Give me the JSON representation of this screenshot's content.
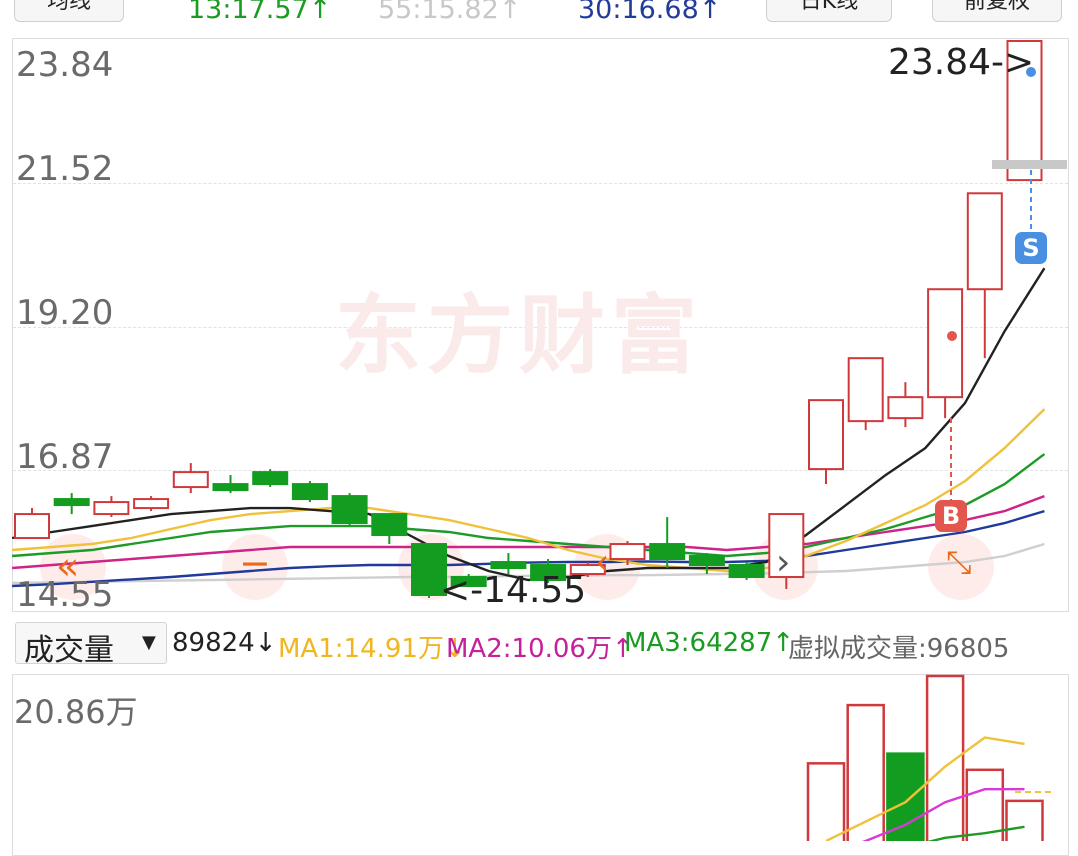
{
  "top": {
    "left_btn": "均线",
    "ma1_value": "13:17.57↑",
    "ma2_value": "55:15.82↑",
    "ma3_value": "30:16.68↑",
    "period_btn": "日K线",
    "fq_btn": "前复权"
  },
  "chart": {
    "y_labels": [
      "23.84",
      "21.52",
      "19.20",
      "16.87",
      "14.55"
    ],
    "max_marker": "23.84->",
    "min_marker": "<-14.55",
    "watermark": "东方财富",
    "signal_s": "S",
    "signal_b": "B"
  },
  "volume_bar": {
    "dropdown_label": "成交量",
    "vol": "89824↓",
    "ma1": "MA1:14.91万↓",
    "ma2": "MA2:10.06万↑",
    "ma3": "MA3:64287↑",
    "virtual": "虚拟成交量:96805"
  },
  "volume_chart": {
    "max_label": "20.86万"
  },
  "colors": {
    "up": "#d0393c",
    "down": "#139d20",
    "ma_black": "#222222",
    "ma_yellow": "#f0c13a",
    "ma_green": "#1e9b26",
    "ma_magenta": "#cc2488",
    "ma_blue": "#1f3a9a",
    "ma_gray": "#cfcfcf"
  },
  "chart_data": {
    "type": "candlestick",
    "ylim": [
      14.55,
      23.84
    ],
    "candles": [
      {
        "open": 15.55,
        "close": 15.95,
        "high": 16.05,
        "low": 15.55
      },
      {
        "open": 16.2,
        "close": 16.1,
        "high": 16.3,
        "low": 15.95
      },
      {
        "open": 15.95,
        "close": 16.15,
        "high": 16.25,
        "low": 15.9
      },
      {
        "open": 16.05,
        "close": 16.2,
        "high": 16.25,
        "low": 16.0
      },
      {
        "open": 16.4,
        "close": 16.65,
        "high": 16.8,
        "low": 16.3
      },
      {
        "open": 16.45,
        "close": 16.35,
        "high": 16.6,
        "low": 16.3
      },
      {
        "open": 16.65,
        "close": 16.45,
        "high": 16.7,
        "low": 16.4
      },
      {
        "open": 16.45,
        "close": 16.2,
        "high": 16.5,
        "low": 16.15
      },
      {
        "open": 16.25,
        "close": 15.8,
        "high": 16.3,
        "low": 15.75
      },
      {
        "open": 15.95,
        "close": 15.6,
        "high": 15.95,
        "low": 15.45
      },
      {
        "open": 15.45,
        "close": 14.6,
        "high": 15.45,
        "low": 14.55
      },
      {
        "open": 14.9,
        "close": 14.75,
        "high": 14.95,
        "low": 14.75
      },
      {
        "open": 15.15,
        "close": 15.05,
        "high": 15.3,
        "low": 14.95
      },
      {
        "open": 15.1,
        "close": 14.85,
        "high": 15.2,
        "low": 14.8
      },
      {
        "open": 14.95,
        "close": 15.1,
        "high": 15.15,
        "low": 14.9
      },
      {
        "open": 15.2,
        "close": 15.45,
        "high": 15.5,
        "low": 15.1
      },
      {
        "open": 15.45,
        "close": 15.2,
        "high": 15.9,
        "low": 15.05
      },
      {
        "open": 15.25,
        "close": 15.1,
        "high": 15.3,
        "low": 14.95
      },
      {
        "open": 15.1,
        "close": 14.9,
        "high": 15.15,
        "low": 14.85
      },
      {
        "open": 14.9,
        "close": 15.95,
        "high": 15.95,
        "low": 14.7
      },
      {
        "open": 16.7,
        "close": 17.85,
        "high": 17.85,
        "low": 16.45
      },
      {
        "open": 17.5,
        "close": 18.55,
        "high": 18.55,
        "low": 17.35
      },
      {
        "open": 17.55,
        "close": 17.9,
        "high": 18.15,
        "low": 17.4
      },
      {
        "open": 17.9,
        "close": 19.7,
        "high": 19.7,
        "low": 17.55
      },
      {
        "open": 19.7,
        "close": 21.3,
        "high": 21.3,
        "low": 18.55
      },
      {
        "open": 21.52,
        "close": 23.84,
        "high": 23.84,
        "low": 21.52
      }
    ],
    "ma_series": [
      {
        "name": "MA black",
        "values": [
          15.55,
          15.65,
          15.75,
          15.85,
          15.95,
          16.0,
          16.05,
          16.05,
          16.0,
          15.95,
          15.6,
          15.25,
          15.0,
          14.85,
          14.9,
          15.0,
          15.05,
          15.05,
          15.05,
          15.15,
          15.6,
          16.1,
          16.6,
          17.05,
          17.8,
          19.0,
          20.05
        ]
      },
      {
        "name": "MA yellow",
        "values": [
          15.35,
          15.4,
          15.45,
          15.55,
          15.7,
          15.85,
          15.95,
          16.0,
          16.05,
          16.05,
          15.95,
          15.85,
          15.7,
          15.55,
          15.35,
          15.2,
          15.1,
          15.05,
          15.0,
          15.05,
          15.25,
          15.5,
          15.8,
          16.1,
          16.5,
          17.05,
          17.7
        ]
      },
      {
        "name": "MA green",
        "values": [
          15.25,
          15.3,
          15.35,
          15.45,
          15.55,
          15.65,
          15.7,
          15.75,
          15.75,
          15.75,
          15.7,
          15.65,
          15.55,
          15.5,
          15.45,
          15.4,
          15.35,
          15.3,
          15.25,
          15.3,
          15.4,
          15.55,
          15.7,
          15.9,
          16.1,
          16.45,
          16.95
        ]
      },
      {
        "name": "MA magenta",
        "values": [
          15.05,
          15.1,
          15.15,
          15.2,
          15.25,
          15.3,
          15.35,
          15.4,
          15.4,
          15.4,
          15.4,
          15.4,
          15.4,
          15.4,
          15.4,
          15.4,
          15.4,
          15.4,
          15.35,
          15.4,
          15.45,
          15.55,
          15.65,
          15.75,
          15.85,
          16.0,
          16.25
        ]
      },
      {
        "name": "MA blue",
        "values": [
          14.75,
          14.78,
          14.82,
          14.86,
          14.9,
          14.95,
          15.0,
          15.05,
          15.08,
          15.1,
          15.1,
          15.1,
          15.12,
          15.14,
          15.15,
          15.15,
          15.16,
          15.15,
          15.15,
          15.17,
          15.25,
          15.35,
          15.45,
          15.55,
          15.65,
          15.8,
          16.0
        ]
      },
      {
        "name": "MA gray",
        "values": [
          14.8,
          14.81,
          14.82,
          14.83,
          14.84,
          14.85,
          14.86,
          14.87,
          14.88,
          14.89,
          14.9,
          14.9,
          14.91,
          14.92,
          14.92,
          14.93,
          14.93,
          14.94,
          14.95,
          14.96,
          14.98,
          15.0,
          15.05,
          15.1,
          15.15,
          15.25,
          15.45
        ]
      }
    ],
    "volume": {
      "max": 208600,
      "bars": [
        {
          "index": 20,
          "value": 120000,
          "dir": "up"
        },
        {
          "index": 21,
          "value": 210000,
          "dir": "up"
        },
        {
          "index": 22,
          "value": 135000,
          "dir": "down"
        },
        {
          "index": 23,
          "value": 260000,
          "dir": "up"
        },
        {
          "index": 24,
          "value": 110000,
          "dir": "up"
        },
        {
          "index": 25,
          "value": 62000,
          "dir": "up"
        }
      ],
      "ma_yellow": [
        [
          20,
          0
        ],
        [
          21,
          30000
        ],
        [
          22,
          60000
        ],
        [
          23,
          115000
        ],
        [
          24,
          160000
        ],
        [
          25,
          150000
        ]
      ],
      "ma_magenta": [
        [
          20,
          -20000
        ],
        [
          21,
          0
        ],
        [
          22,
          25000
        ],
        [
          23,
          60000
        ],
        [
          24,
          80000
        ],
        [
          25,
          80000
        ]
      ],
      "ma_green": [
        [
          20,
          -50000
        ],
        [
          21,
          -30000
        ],
        [
          22,
          -10000
        ],
        [
          23,
          5000
        ],
        [
          24,
          12000
        ],
        [
          25,
          22000
        ]
      ]
    }
  }
}
